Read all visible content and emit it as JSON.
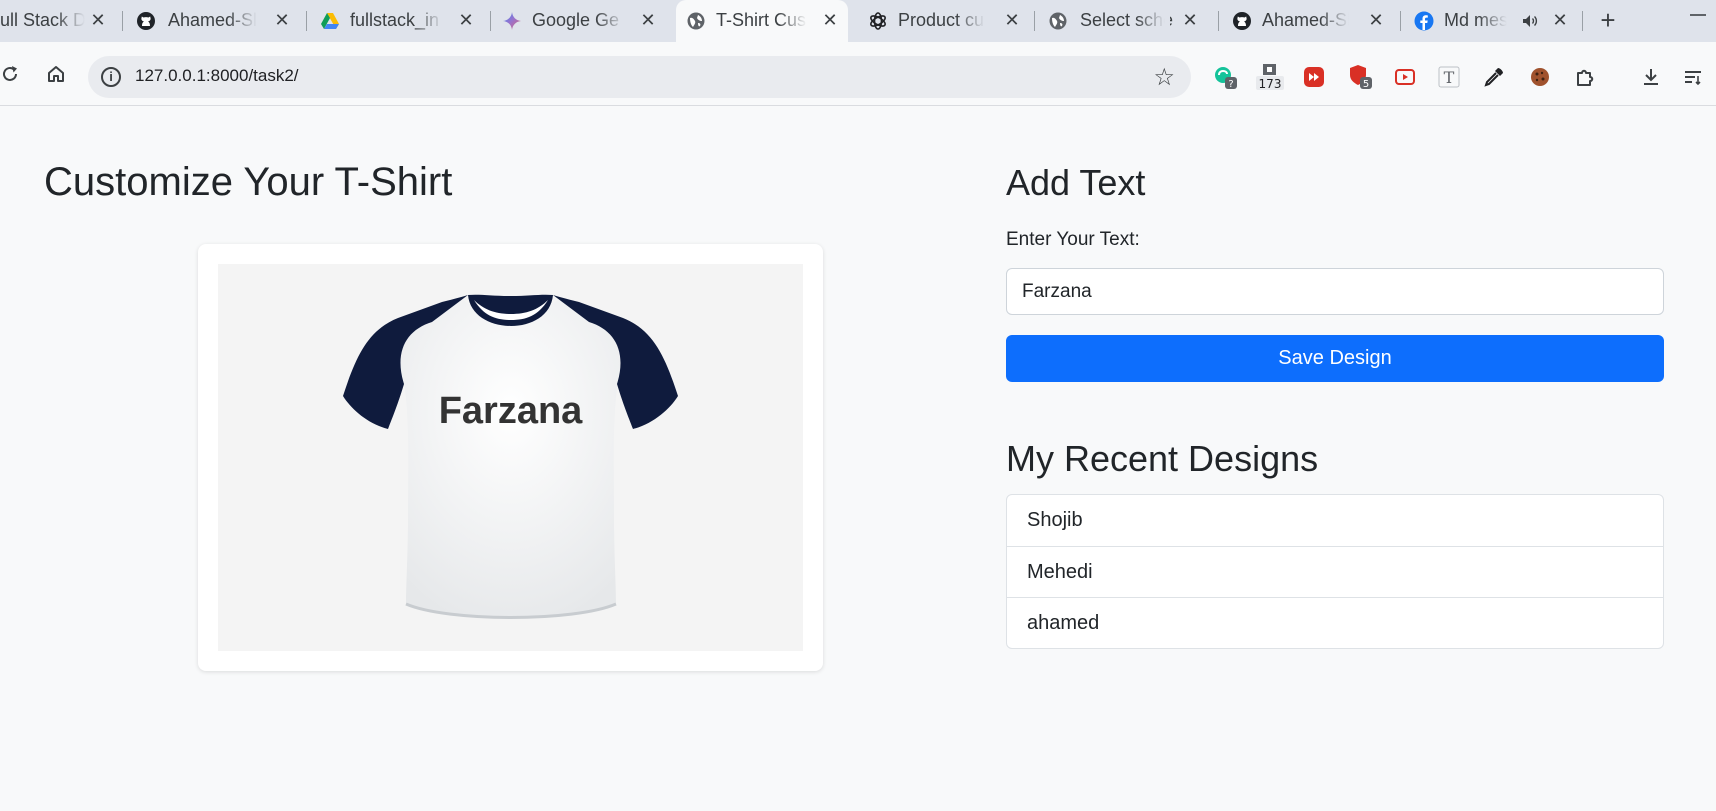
{
  "browser": {
    "tabs": [
      {
        "title": "ull Stack D",
        "icon": "globe-icon"
      },
      {
        "title": "Ahamed-Sl",
        "icon": "github-icon"
      },
      {
        "title": "fullstack_in",
        "icon": "google-drive-icon"
      },
      {
        "title": "Google Ge",
        "icon": "gemini-icon"
      },
      {
        "title": "T-Shirt Cus",
        "icon": "globe-icon",
        "active": true
      },
      {
        "title": "Product cu",
        "icon": "openai-icon"
      },
      {
        "title": "Select sche",
        "icon": "globe-icon"
      },
      {
        "title": "Ahamed-Sl",
        "icon": "github-icon"
      },
      {
        "title": "Md mes",
        "icon": "facebook-icon",
        "audio": true
      }
    ],
    "url": "127.0.0.1:8000/task2/",
    "extensions": [
      {
        "name": "grammar-extension-icon",
        "badge": "?"
      },
      {
        "name": "counter-extension-icon",
        "badge": "173"
      },
      {
        "name": "fast-forward-extension-icon",
        "badge": ""
      },
      {
        "name": "shield-extension-icon",
        "badge": "5"
      },
      {
        "name": "youtube-extension-icon",
        "badge": ""
      },
      {
        "name": "font-extension-icon",
        "badge": "T"
      },
      {
        "name": "eyedropper-extension-icon",
        "badge": ""
      },
      {
        "name": "cookie-extension-icon",
        "badge": ""
      },
      {
        "name": "puzzle-extensions-icon",
        "badge": ""
      }
    ],
    "colors": {
      "tabbar": "#dfe3eb",
      "toolbar": "#f8f9fa",
      "omnibox": "#e9ebef"
    }
  },
  "page": {
    "title": "Customize Your T-Shirt",
    "preview_text": "Farzana",
    "add_text": {
      "heading": "Add Text",
      "label": "Enter Your Text:",
      "value": "Farzana",
      "save_label": "Save Design"
    },
    "recent": {
      "heading": "My Recent Designs",
      "items": [
        "Shojib",
        "Mehedi",
        "ahamed"
      ]
    },
    "colors": {
      "accent": "#0d6efd",
      "shirt_body": "#ffffff",
      "shirt_sleeves": "#0f1b3d",
      "background": "#f8f9fa"
    }
  }
}
